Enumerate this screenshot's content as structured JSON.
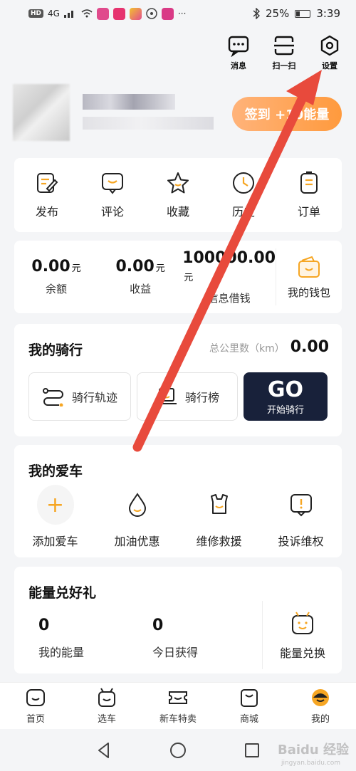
{
  "status_bar": {
    "network": "HD",
    "signal": "4G",
    "battery": "25%",
    "time": "3:39"
  },
  "header": {
    "actions": [
      {
        "label": "消息",
        "icon": "message-icon"
      },
      {
        "label": "扫一扫",
        "icon": "scan-icon"
      },
      {
        "label": "设置",
        "icon": "settings-icon"
      }
    ]
  },
  "profile": {
    "checkin_label": "签到 +10能量"
  },
  "quick_actions": [
    {
      "label": "发布",
      "icon": "publish-icon"
    },
    {
      "label": "评论",
      "icon": "comment-icon"
    },
    {
      "label": "收藏",
      "icon": "star-icon"
    },
    {
      "label": "历史",
      "icon": "clock-icon"
    },
    {
      "label": "订单",
      "icon": "order-icon"
    }
  ],
  "wallet": {
    "items": [
      {
        "value": "0.00",
        "unit": "元",
        "label": "余额"
      },
      {
        "value": "0.00",
        "unit": "元",
        "label": "收益"
      },
      {
        "value": "100000.00",
        "unit": "元",
        "label": "信息借钱"
      }
    ],
    "my_wallet_label": "我的钱包"
  },
  "ride": {
    "title": "我的骑行",
    "total_label": "总公里数（km）",
    "total_value": "0.00",
    "track_label": "骑行轨迹",
    "rank_label": "骑行榜",
    "go_label": "GO",
    "go_sub_label": "开始骑行"
  },
  "car": {
    "title": "我的爱车",
    "items": [
      {
        "label": "添加爱车",
        "icon": "plus-icon"
      },
      {
        "label": "加油优惠",
        "icon": "fuel-drop-icon"
      },
      {
        "label": "维修救援",
        "icon": "repair-icon"
      },
      {
        "label": "投诉维权",
        "icon": "complaint-icon"
      }
    ]
  },
  "energy": {
    "title": "能量兑好礼",
    "my_energy_value": "0",
    "my_energy_label": "我的能量",
    "today_value": "0",
    "today_label": "今日获得",
    "exchange_label": "能量兑换"
  },
  "tabbar": [
    {
      "label": "首页",
      "icon": "home-icon"
    },
    {
      "label": "选车",
      "icon": "choose-car-icon"
    },
    {
      "label": "新车特卖",
      "icon": "ticket-icon"
    },
    {
      "label": "商城",
      "icon": "mall-icon"
    },
    {
      "label": "我的",
      "icon": "profile-icon",
      "active": true
    }
  ],
  "watermark": {
    "text": "Baidu 经验",
    "sub": "jingyan.baidu.com"
  },
  "colors": {
    "accent": "#f6a623",
    "checkin_gradient_start": "#ffb37a",
    "checkin_gradient_end": "#ff9a3d",
    "go_button": "#18213a",
    "arrow": "#e84a3c"
  }
}
